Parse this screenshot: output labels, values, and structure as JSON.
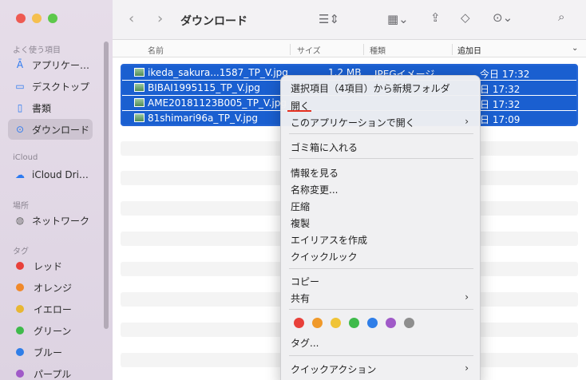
{
  "sidebar": {
    "favorites_header": "よく使う項目",
    "favorites": [
      {
        "label": "アプリケー…",
        "icon": "applications-icon"
      },
      {
        "label": "デスクトップ",
        "icon": "desktop-icon"
      },
      {
        "label": "書類",
        "icon": "document-icon"
      },
      {
        "label": "ダウンロード",
        "icon": "download-icon",
        "active": true
      }
    ],
    "icloud_header": "iCloud",
    "icloud": [
      {
        "label": "iCloud Dri…",
        "icon": "cloud-icon"
      }
    ],
    "locations_header": "場所",
    "locations": [
      {
        "label": "ネットワーク",
        "icon": "globe-icon"
      }
    ],
    "tags_header": "タグ",
    "tags": [
      {
        "label": "レッド",
        "color": "#e8403a"
      },
      {
        "label": "オレンジ",
        "color": "#f0892a"
      },
      {
        "label": "イエロー",
        "color": "#e8b733"
      },
      {
        "label": "グリーン",
        "color": "#3fba4b"
      },
      {
        "label": "ブルー",
        "color": "#2f7ee8"
      },
      {
        "label": "パープル",
        "color": "#a05ac8"
      }
    ]
  },
  "toolbar": {
    "title": "ダウンロード"
  },
  "columns": {
    "name": "名前",
    "size": "サイズ",
    "kind": "種類",
    "date": "追加日"
  },
  "files": [
    {
      "name": "ikeda_sakura...1587_TP_V.jpg",
      "size": "1.2 MB",
      "kind": "JPEGイメージ",
      "date": "今日 17:32"
    },
    {
      "name": "BIBAI1995115_TP_V.jpg",
      "size": "",
      "kind": "",
      "date": "日 17:32"
    },
    {
      "name": "AME20181123B005_TP_V.jpg",
      "size": "",
      "kind": "",
      "date": "日 17:32"
    },
    {
      "name": "81shimari96a_TP_V.jpg",
      "size": "",
      "kind": "",
      "date": "日 17:09"
    }
  ],
  "context_menu": {
    "new_folder": "選択項目（4項目）から新規フォルダ",
    "open": "開く",
    "open_with": "このアプリケーションで開く",
    "trash": "ゴミ箱に入れる",
    "get_info": "情報を見る",
    "rename": "名称変更...",
    "compress": "圧縮",
    "duplicate": "複製",
    "make_alias": "エイリアスを作成",
    "quick_look": "クイックルック",
    "copy": "コピー",
    "share": "共有",
    "tags": "タグ...",
    "quick_actions": "クイックアクション",
    "tag_colors": [
      "#e8403a",
      "#f0992a",
      "#f0c437",
      "#3fba4b",
      "#2f7ee8",
      "#a05ac8",
      "#8e8e8e"
    ]
  }
}
